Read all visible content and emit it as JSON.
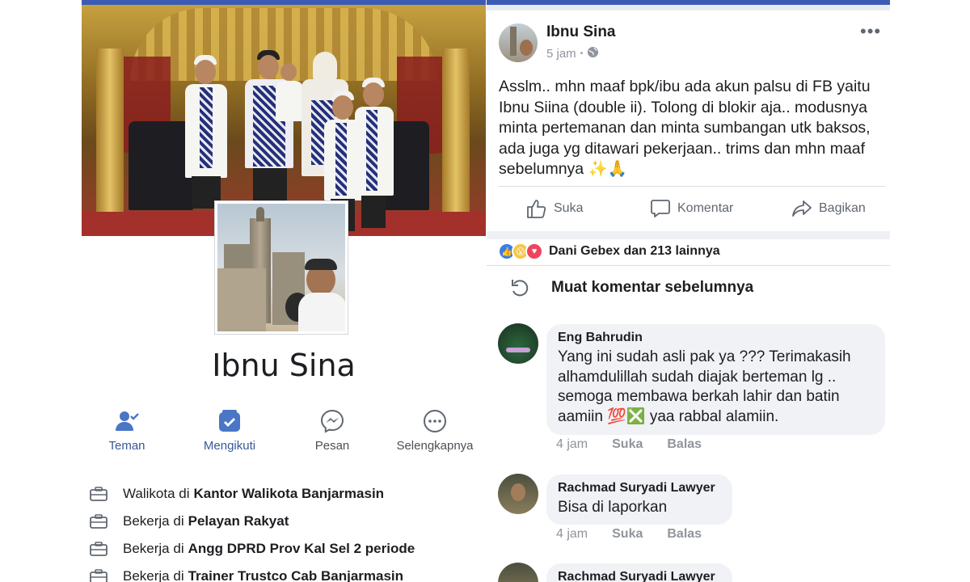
{
  "profile": {
    "name": "Ibnu Sina",
    "actions": [
      {
        "label": "Teman",
        "icon": "friend-check-icon"
      },
      {
        "label": "Mengikuti",
        "icon": "following-check-icon"
      },
      {
        "label": "Pesan",
        "icon": "messenger-icon"
      },
      {
        "label": "Selengkapnya",
        "icon": "more-circle-icon"
      }
    ],
    "info": [
      {
        "prefix": "Walikota di",
        "place": "Kantor Walikota Banjarmasin"
      },
      {
        "prefix": "Bekerja di",
        "place": "Pelayan Rakyat"
      },
      {
        "prefix": "Bekerja di",
        "place": "Angg DPRD Prov Kal Sel 2 periode"
      },
      {
        "prefix": "Bekerja di",
        "place": "Trainer Trustco Cab Banjarmasin"
      }
    ]
  },
  "post": {
    "author": "Ibnu Sina",
    "time": "5 jam",
    "privacy_icon": "globe-icon",
    "text": "Asslm.. mhn maaf bpk/ibu ada akun palsu di FB yaitu Ibnu Siina (double ii). Tolong di blokir aja.. modusnya minta pertemanan dan minta sumbangan utk baksos, ada juga yg ditawari pekerjaan.. trims dan mhn maaf sebelumnya ✨🙏",
    "buttons": {
      "like": "Suka",
      "comment": "Komentar",
      "share": "Bagikan"
    },
    "reactions_text": "Dani Gebex dan 213 lainnya",
    "reaction_icons": [
      "like-reaction-icon",
      "wow-reaction-icon",
      "love-reaction-icon"
    ]
  },
  "comments_section": {
    "load_more": "Muat komentar sebelumnya"
  },
  "comments": [
    {
      "name": "Eng Bahrudin",
      "text": "Yang ini sudah asli pak ya ??? Terimakasih alhamdulillah sudah diajak berteman lg .. semoga membawa berkah lahir dan batin aamiin 💯❎ yaa rabbal alamiin.",
      "time": "4 jam",
      "like": "Suka",
      "reply": "Balas"
    },
    {
      "name": "Rachmad Suryadi Lawyer",
      "text": "Bisa di laporkan",
      "time": "4 jam",
      "like": "Suka",
      "reply": "Balas"
    },
    {
      "name": "Rachmad Suryadi Lawyer"
    }
  ],
  "colors": {
    "brand": "#3b5bb5",
    "active": "#385898",
    "muted": "#90949c"
  }
}
